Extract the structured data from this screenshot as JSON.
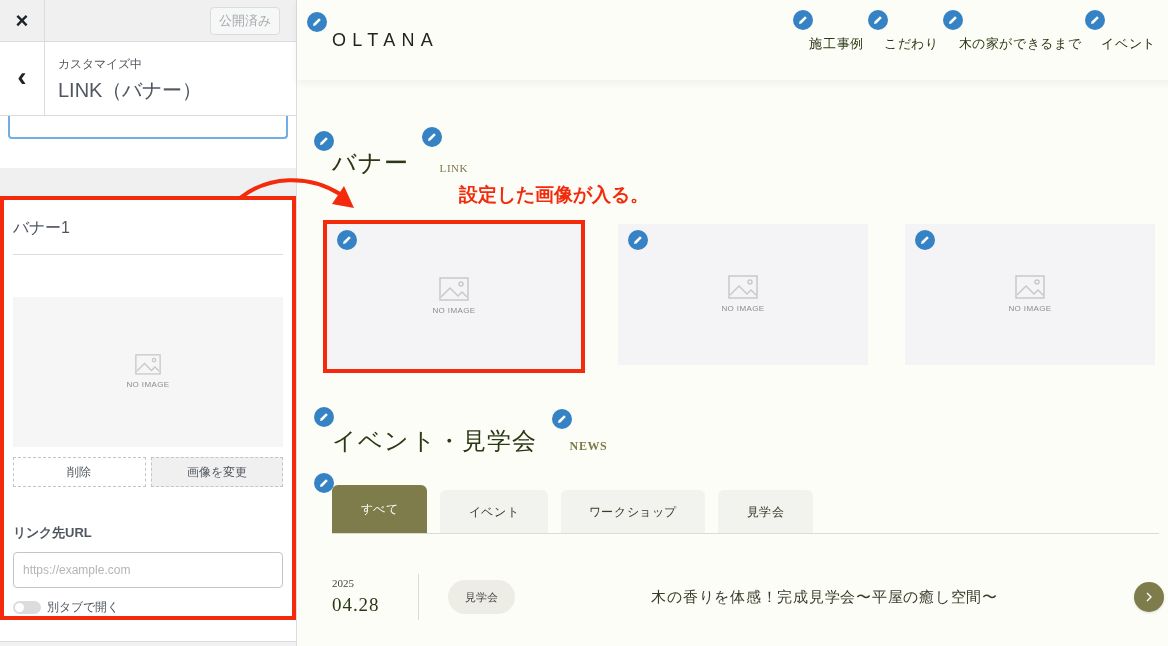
{
  "sidebar": {
    "close": "×",
    "publish_button": {
      "label": "公開済み",
      "disabled": true
    },
    "back": "‹",
    "subtitle": "カスタマイズ中",
    "title": "LINK（バナー）",
    "banner_panel": {
      "title": "バナー1",
      "image_placeholder": "NO IMAGE",
      "remove_button": "削除",
      "change_button": "画像を変更",
      "url_label": "リンク先URL",
      "url_placeholder": "https://example.com",
      "new_tab": {
        "label": "別タブで開く",
        "on": false
      }
    }
  },
  "preview": {
    "logo": "OLTANA",
    "nav": [
      "施工事例",
      "こだわり",
      "木の家ができるまで",
      "イベント"
    ],
    "banner_section": {
      "title": "バナー",
      "subtitle": "LINK",
      "annotation": "設定した画像が入る。",
      "banners": [
        {
          "placeholder": "NO IMAGE",
          "highlighted": true
        },
        {
          "placeholder": "NO IMAGE",
          "highlighted": false
        },
        {
          "placeholder": "NO IMAGE",
          "highlighted": false
        }
      ]
    },
    "event_section": {
      "title": "イベント・見学会",
      "subtitle": "NEWS",
      "tabs": [
        {
          "label": "すべて",
          "selected": true
        },
        {
          "label": "イベント",
          "selected": false
        },
        {
          "label": "ワークショップ",
          "selected": false
        },
        {
          "label": "見学会",
          "selected": false
        }
      ],
      "events": [
        {
          "year": "2025",
          "date": "04.28",
          "tag": "見学会",
          "title": "木の香りを体感！完成見学会〜平屋の癒し空間〜"
        }
      ]
    }
  }
}
